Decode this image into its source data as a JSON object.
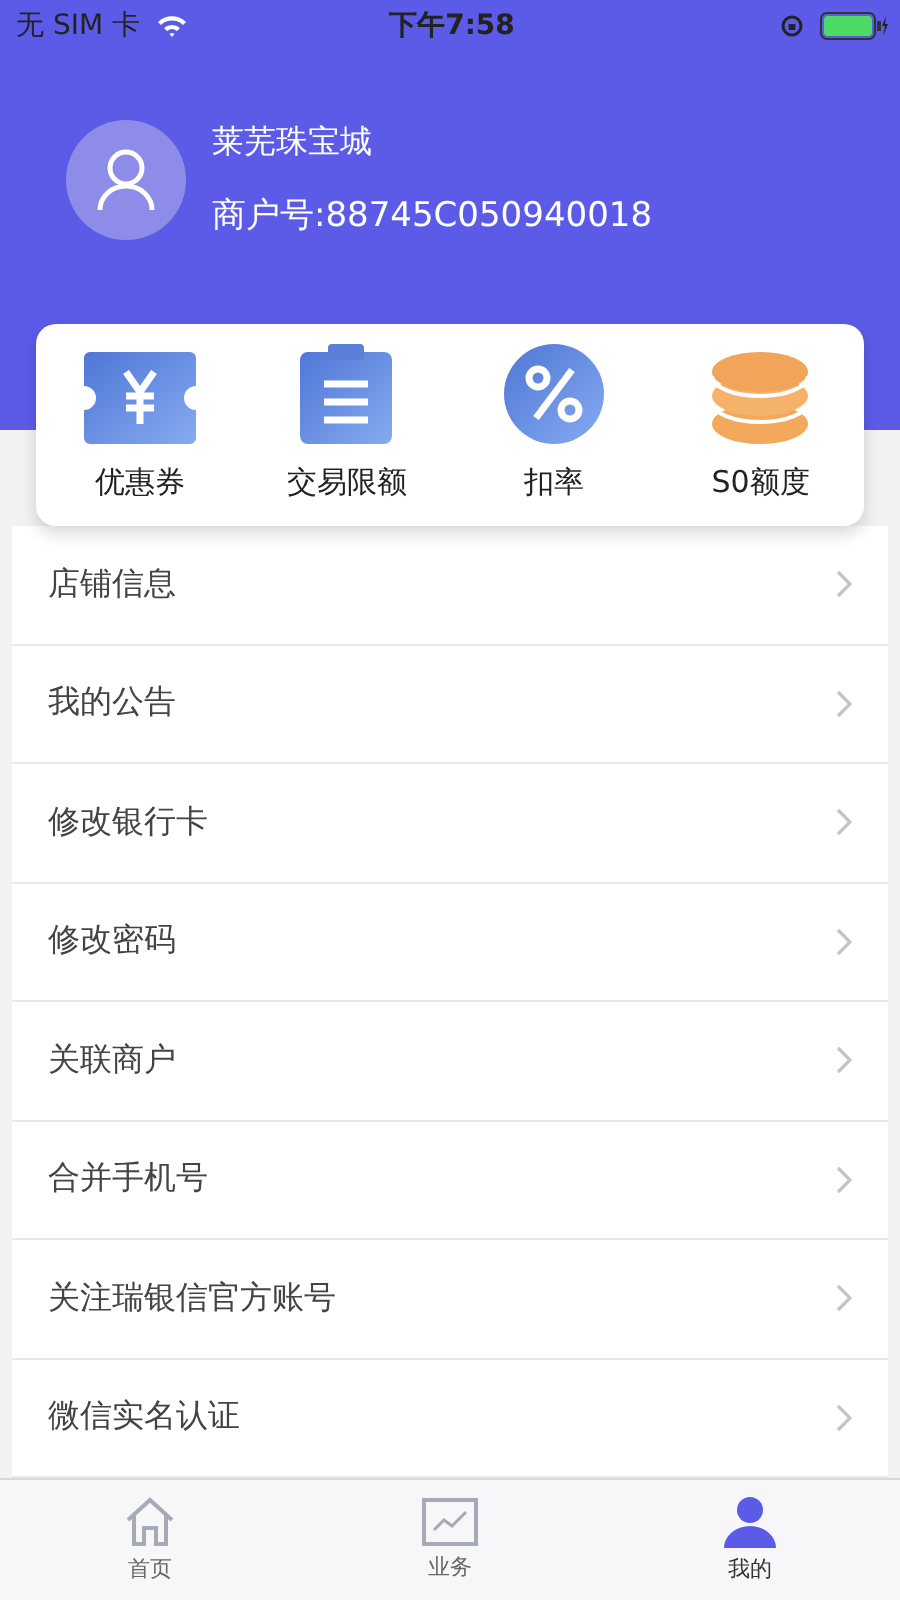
{
  "status_bar": {
    "carrier": "无 SIM 卡",
    "time": "下午7:58"
  },
  "profile": {
    "name": "莱芜珠宝城",
    "merchant_id": "商户号:88745C050940018"
  },
  "shortcuts": [
    {
      "kind": "coupon",
      "label": "优惠券"
    },
    {
      "kind": "clipboard",
      "label": "交易限额"
    },
    {
      "kind": "percent",
      "label": "扣率"
    },
    {
      "kind": "coins",
      "label": "S0额度"
    }
  ],
  "menu": [
    {
      "label": "店铺信息"
    },
    {
      "label": "我的公告"
    },
    {
      "label": "修改银行卡"
    },
    {
      "label": "修改密码"
    },
    {
      "label": "关联商户"
    },
    {
      "label": "合并手机号"
    },
    {
      "label": "关注瑞银信官方账号"
    },
    {
      "label": "微信实名认证"
    }
  ],
  "tab_bar": [
    {
      "kind": "home",
      "label": "首页",
      "selected": false
    },
    {
      "kind": "chart",
      "label": "业务",
      "selected": false
    },
    {
      "kind": "person",
      "label": "我的",
      "selected": true
    }
  ]
}
